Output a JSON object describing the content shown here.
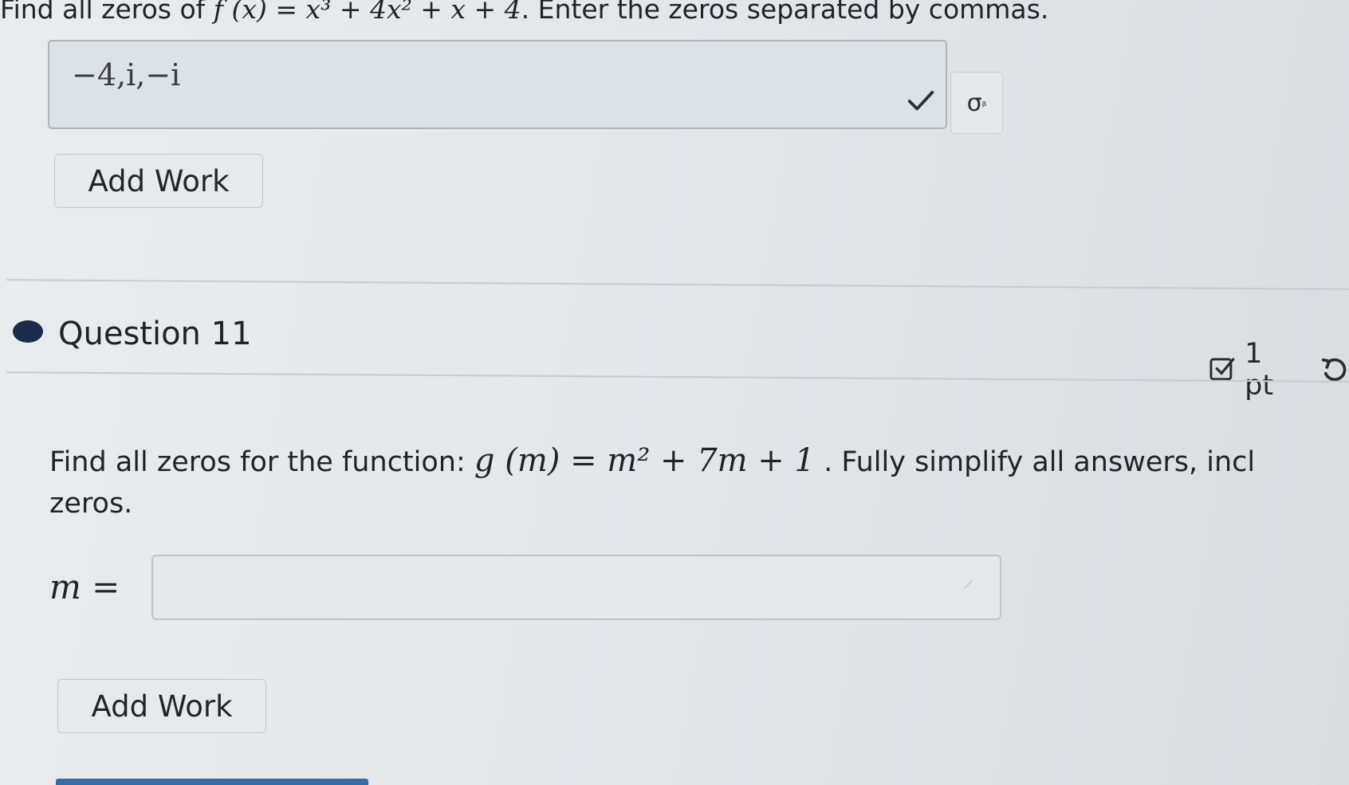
{
  "question10": {
    "prompt_prefix": "Find all zeros of",
    "function": "f (x) = x³ + 4x² + x + 4",
    "prompt_suffix": ". Enter the zeros separated by commas.",
    "answer_value": "−4,i,−i",
    "answer_status": "correct",
    "add_work_label": "Add Work"
  },
  "question11": {
    "title": "Question 11",
    "points": "1 pt",
    "prompt_prefix": "Find all zeros for the function:",
    "function": "g (m) = m² + 7m + 1",
    "prompt_suffix": ". Fully simplify all answers, incl",
    "prompt_continuation": "zeros.",
    "input_label": "m =",
    "input_value": "",
    "add_work_label": "Add Work"
  },
  "icons": {
    "check": "check-icon",
    "sigma": "sigma-button",
    "points_check": "checkbox-icon",
    "undo": "undo-icon",
    "pencil": "pencil-icon"
  },
  "colors": {
    "dot": "#1b2c4a",
    "bottom_bar": "#2f6ea8"
  }
}
